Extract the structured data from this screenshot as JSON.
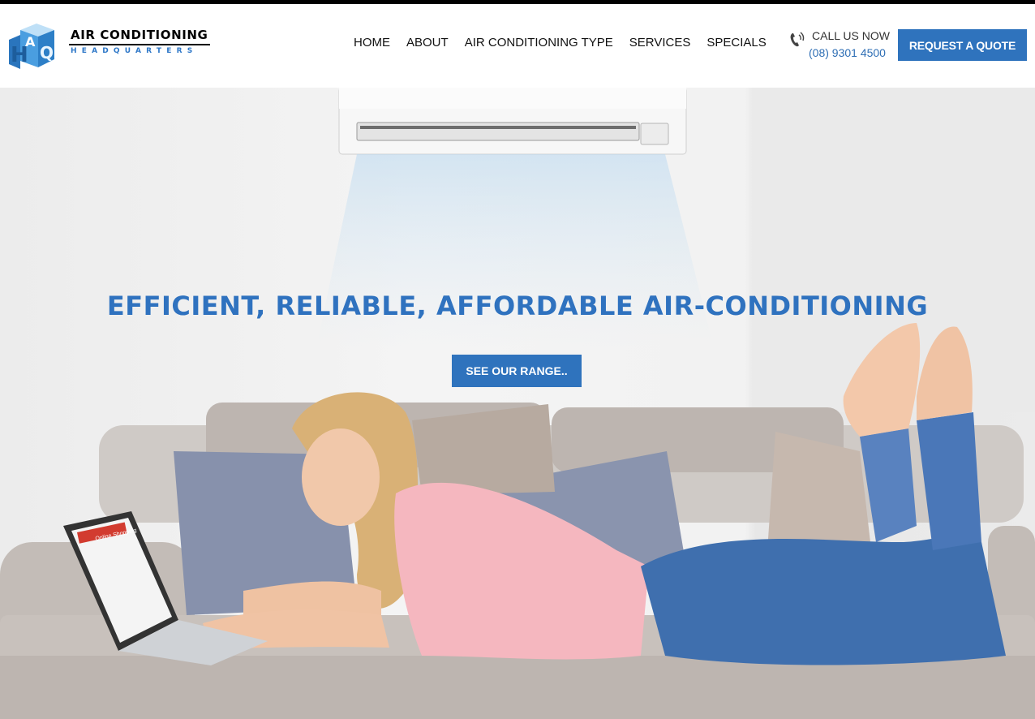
{
  "brand": {
    "name_line1": "AIR CONDITIONING",
    "name_line2": "HEADQUARTERS",
    "logo_icon": "ahq-cube-logo",
    "colors": {
      "primary": "#2f73bd",
      "logo_blue": "#3a8fd6",
      "text": "#111111"
    }
  },
  "nav": {
    "items": [
      {
        "label": "HOME"
      },
      {
        "label": "ABOUT"
      },
      {
        "label": "AIR CONDITIONING TYPE"
      },
      {
        "label": "SERVICES"
      },
      {
        "label": "SPECIALS"
      }
    ]
  },
  "contact": {
    "icon": "phone-icon",
    "label": "CALL US NOW",
    "phone": "(08) 9301 4500"
  },
  "header_cta": {
    "label": "REQUEST A QUOTE"
  },
  "hero": {
    "headline": "EFFICIENT, RELIABLE, AFFORDABLE AIR-CONDITIONING",
    "cta_label": "SEE OUR RANGE..",
    "laptop_screen_text": "Online Shopping"
  }
}
